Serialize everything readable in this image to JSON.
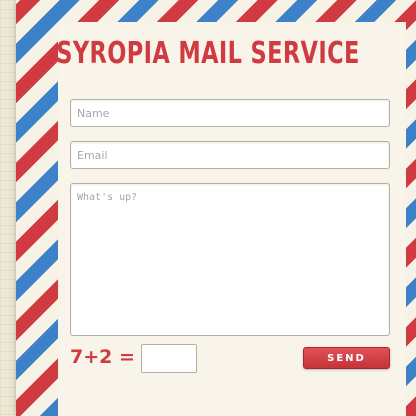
{
  "title": "SYROPIA MAIL SERVICE",
  "form": {
    "name_placeholder": "Name",
    "email_placeholder": "Email",
    "message_placeholder": "What's up?",
    "captcha_question": "7+2 =",
    "captcha_answer_value": "",
    "send_label": "SEND"
  },
  "colors": {
    "stripe_red": "#cf3b40",
    "stripe_blue": "#3d82c8",
    "paper": "#f8f4ea",
    "accent": "#cf3b40"
  }
}
